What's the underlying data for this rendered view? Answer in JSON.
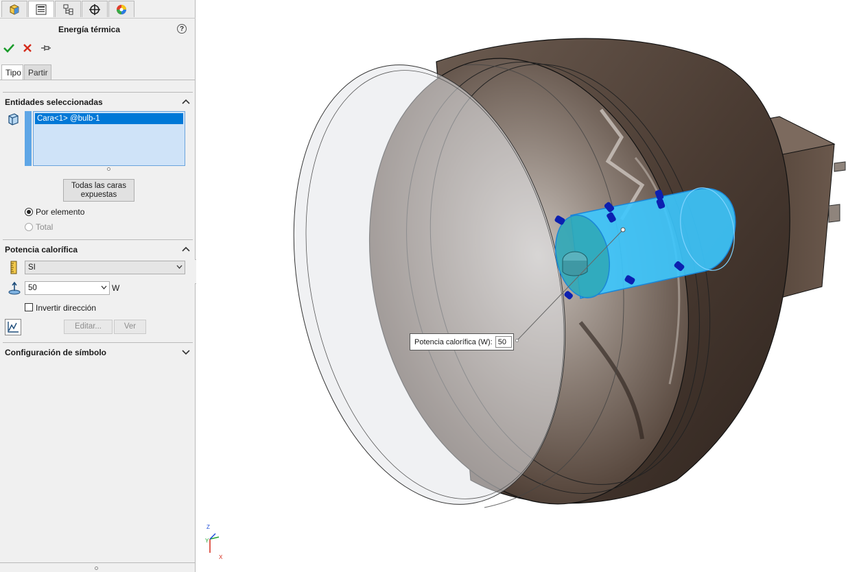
{
  "panel": {
    "title": "Energía térmica",
    "help_label": "?",
    "tabs": [
      {
        "icon": "feature-manager-icon"
      },
      {
        "icon": "property-manager-icon"
      },
      {
        "icon": "configuration-manager-icon"
      },
      {
        "icon": "dimxpert-manager-icon"
      },
      {
        "icon": "display-manager-icon"
      }
    ],
    "actions": {
      "ok_icon": "check-icon",
      "cancel_icon": "close-icon",
      "pin_icon": "pushpin-icon"
    },
    "subtabs": {
      "type_label": "Tipo",
      "split_label": "Partir"
    },
    "selected_entities": {
      "header": "Entidades seleccionadas",
      "items": [
        "Cara<1> @bulb-1"
      ],
      "all_faces_button": "Todas las caras expuestas",
      "options": [
        {
          "label": "Por elemento",
          "selected": true,
          "enabled": true
        },
        {
          "label": "Total",
          "selected": false,
          "enabled": false
        }
      ]
    },
    "heat_power": {
      "header": "Potencia calorífica",
      "units_value": "SI",
      "power_value": "50",
      "power_unit": "W",
      "reverse_label": "Invertir dirección",
      "reverse_checked": false,
      "edit_button": "Editar...",
      "view_button": "Ver"
    },
    "symbol_settings": {
      "header": "Configuración de símbolo"
    }
  },
  "viewport": {
    "callout_label": "Potencia calorífica (W):",
    "callout_value": "50",
    "triad_labels": {
      "x": "X",
      "y": "Y",
      "z": "Z"
    }
  },
  "colors": {
    "accent": "#0078d7",
    "selection_face": "#3cc8ff",
    "ok_green": "#1a9b2a",
    "cancel_red": "#d42a1a",
    "bulb_glass": "#d8dce2",
    "reflector_brown": "#5a4a40"
  }
}
